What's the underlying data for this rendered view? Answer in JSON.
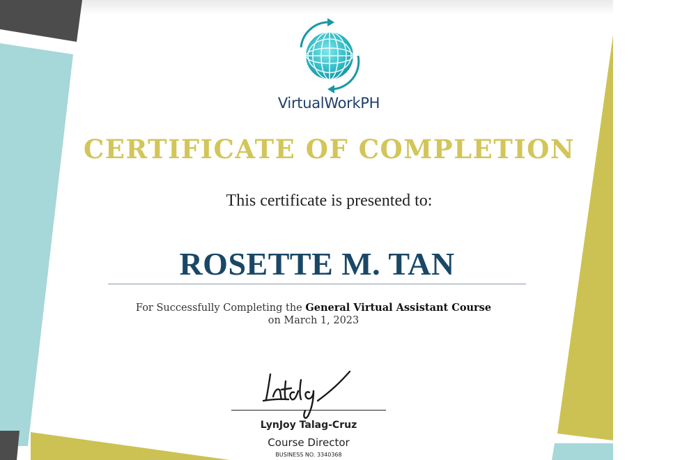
{
  "brand": {
    "name": "VirtualWorkPH"
  },
  "certificate": {
    "title": "CERTIFICATE OF COMPLETION",
    "presented_text": "This certificate is presented to:",
    "recipient": "ROSETTE M. TAN",
    "reason_prefix": "For Successfully Completing the ",
    "course": "General Virtual Assistant Course",
    "date_text": "on March 1, 2023"
  },
  "signatory": {
    "name": "LynJoy Talag-Cruz",
    "role": "Course Director",
    "business_no": "BUSINESS NO. 3340368",
    "signature_text": "Intalag"
  },
  "colors": {
    "gold": "#d3c55a",
    "teal": "#a6d7d9",
    "charcoal": "#4c4c4c",
    "olive": "#ccc253",
    "navy": "#1a4766",
    "brand_blue": "#1f3f6b"
  },
  "icons": [
    "globe-logo-icon",
    "signature"
  ]
}
